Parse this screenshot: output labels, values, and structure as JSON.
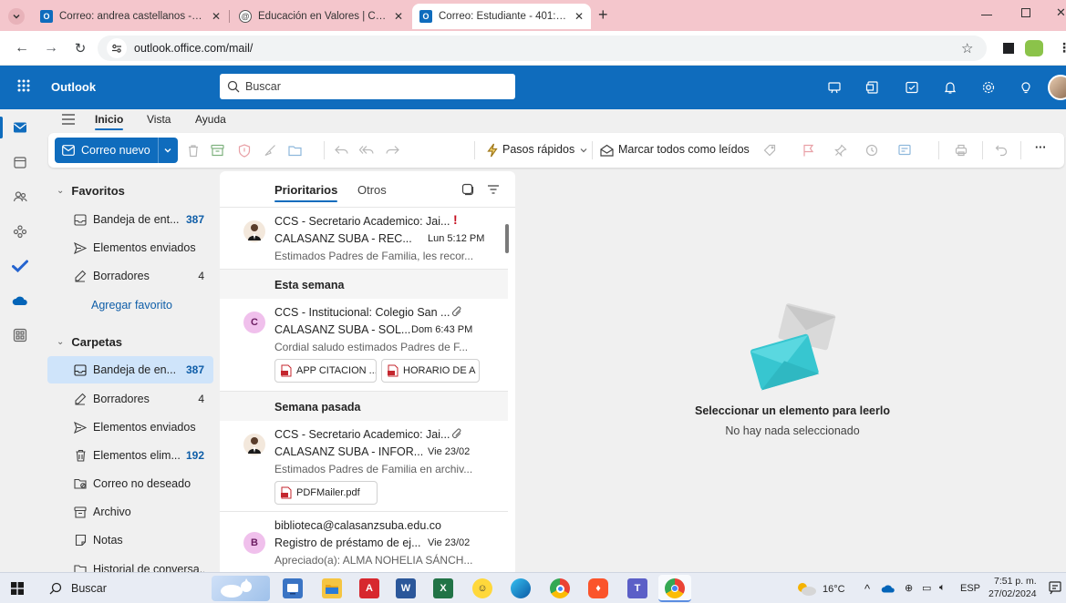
{
  "browser": {
    "tabs": [
      {
        "title": "Correo: andrea castellanos - Ou",
        "favicon": "outlook-favicon"
      },
      {
        "title": "Educación en Valores | COLEGIO",
        "favicon": "generic-favicon"
      },
      {
        "title": "Correo: Estudiante - 401: Alma",
        "favicon": "outlook-favicon"
      }
    ],
    "new_tab_label": "+",
    "address": "outlook.office.com/mail/"
  },
  "outlook": {
    "app_name": "Outlook",
    "search_placeholder": "Buscar",
    "ribbon_tabs": [
      "Inicio",
      "Vista",
      "Ayuda"
    ],
    "ribbon": {
      "new_mail": "Correo nuevo",
      "quick_steps": "Pasos rápidos",
      "mark_all_read": "Marcar todos como leídos",
      "more": "···"
    },
    "folders": {
      "favorites_title": "Favoritos",
      "favorites": [
        {
          "label": "Bandeja de ent...",
          "count": "387",
          "icon": "inbox-icon"
        },
        {
          "label": "Elementos enviados",
          "count": "",
          "icon": "send-icon"
        },
        {
          "label": "Borradores",
          "count": "4",
          "icon": "drafts-icon"
        }
      ],
      "add_favorite": "Agregar favorito",
      "folders_title": "Carpetas",
      "items": [
        {
          "label": "Bandeja de en...",
          "count": "387",
          "icon": "inbox-icon"
        },
        {
          "label": "Borradores",
          "count": "4",
          "icon": "drafts-icon"
        },
        {
          "label": "Elementos enviados",
          "count": "",
          "icon": "send-icon"
        },
        {
          "label": "Elementos elim...",
          "count": "192",
          "icon": "trash-icon"
        },
        {
          "label": "Correo no deseado",
          "count": "",
          "icon": "junk-icon"
        },
        {
          "label": "Archivo",
          "count": "",
          "icon": "archive-icon"
        },
        {
          "label": "Notas",
          "count": "",
          "icon": "notes-icon"
        },
        {
          "label": "Historial de conversa...",
          "count": "",
          "icon": "history-icon"
        }
      ]
    },
    "list_tabs": {
      "focused": "Prioritarios",
      "other": "Otros"
    },
    "groups": {
      "this_week": "Esta semana",
      "last_week": "Semana pasada"
    },
    "messages": [
      {
        "from": "CCS - Secretario Academico: Jai...",
        "subject": "CALASANZ SUBA - REC...",
        "time": "Lun 5:12 PM",
        "preview": "Estimados Padres de Familia, les recor...",
        "initial": "",
        "attachments": []
      },
      {
        "from": "CCS - Institucional: Colegio San ...",
        "subject": "CALASANZ SUBA - SOL...",
        "time": "Dom 6:43 PM",
        "preview": "Cordial saludo estimados Padres de F...",
        "initial": "C",
        "attachments": [
          "APP CITACION ...",
          "HORARIO DE A"
        ]
      },
      {
        "from": "CCS - Secretario Academico: Jai...",
        "subject": "CALASANZ SUBA - INFOR...",
        "time": "Vie 23/02",
        "preview": "Estimados Padres de Familia en archiv...",
        "initial": "",
        "attachments": [
          "PDFMailer.pdf"
        ]
      },
      {
        "from": "biblioteca@calasanzsuba.edu.co",
        "subject": "Registro de préstamo de ej...",
        "time": "Vie 23/02",
        "preview": "Apreciado(a): ALMA NOHELIA SÁNCH...",
        "initial": "B",
        "attachments": []
      }
    ],
    "reading_pane": {
      "title": "Seleccionar un elemento para leerlo",
      "subtitle": "No hay nada seleccionado"
    }
  },
  "taskbar": {
    "search": "Buscar",
    "weather": "16°C",
    "language": "ESP",
    "time": "7:51 p. m.",
    "date": "27/02/2024"
  },
  "colors": {
    "brand": "#0f6cbd",
    "selected": "#cfe4fa",
    "tabstrip": "#f4c6cc"
  }
}
